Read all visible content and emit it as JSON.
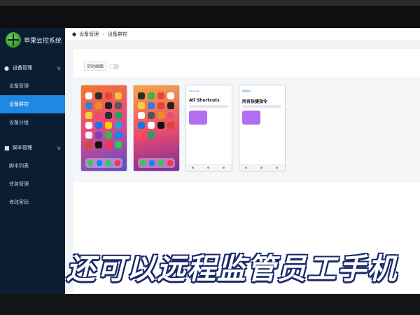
{
  "app": {
    "title": "苹果云控系统"
  },
  "sidebar": {
    "groups": [
      {
        "label": "设备管理",
        "items": [
          "设备管理",
          "设备群控",
          "设备分组"
        ]
      },
      {
        "label": "脚本管理",
        "items": [
          "脚本列表",
          "任务管理",
          "修改密码"
        ]
      }
    ],
    "active_item": "设备群控"
  },
  "breadcrumb": {
    "parent": "设备管理",
    "current": "设备群控"
  },
  "toolbar": {
    "realtime_label": "实时画面",
    "realtime_toggle": "off"
  },
  "phones": [
    {
      "type": "home"
    },
    {
      "type": "home"
    },
    {
      "type": "shortcuts",
      "top_label": "Shortcuts",
      "title": "All Shortcuts"
    },
    {
      "type": "shortcuts",
      "top_label": "快捷指令",
      "title": "所有快捷指令"
    }
  ],
  "banner": "还可以远程监管员工手机",
  "colors": {
    "sidebar": "#0b1d33",
    "accent": "#1e88e5",
    "banner_stroke": "#1b2a6b"
  }
}
